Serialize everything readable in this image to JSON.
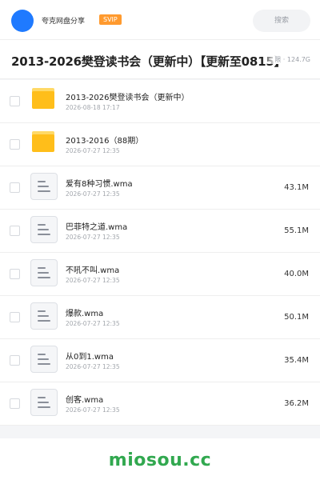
{
  "topbar": {
    "brand": "夸克网盘分享",
    "badge": "SVIP",
    "search_label": "搜索"
  },
  "header": {
    "title": "2013-2026樊登读书会（更新中）【更新至0815】",
    "meta": "限 · 124.7G"
  },
  "files": [
    {
      "type": "folder",
      "name": "2013-2026樊登读书会（更新中）",
      "date": "2026-08-18 17:17",
      "size": ""
    },
    {
      "type": "folder",
      "name": "2013-2016（88期）",
      "date": "2026-07-27 12:35",
      "size": ""
    },
    {
      "type": "file",
      "name": "爱有8种习惯.wma",
      "date": "2026-07-27 12:35",
      "size": "43.1M"
    },
    {
      "type": "file",
      "name": "巴菲特之道.wma",
      "date": "2026-07-27 12:35",
      "size": "55.1M"
    },
    {
      "type": "file",
      "name": "不吼不叫.wma",
      "date": "2026-07-27 12:35",
      "size": "40.0M"
    },
    {
      "type": "file",
      "name": "爆款.wma",
      "date": "2026-07-27 12:35",
      "size": "50.1M"
    },
    {
      "type": "file",
      "name": "从0到1.wma",
      "date": "2026-07-27 12:35",
      "size": "35.4M"
    },
    {
      "type": "file",
      "name": "创客.wma",
      "date": "2026-07-27 12:35",
      "size": "36.2M"
    }
  ],
  "footer": {
    "watermark": "miosou.cc"
  }
}
